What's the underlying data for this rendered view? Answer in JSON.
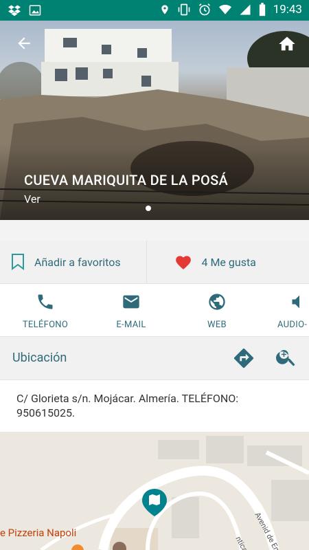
{
  "status_bar": {
    "time": "19:43"
  },
  "hero": {
    "title": "CUEVA MARIQUITA DE LA POSÁ",
    "subtitle": "Ver"
  },
  "actions": {
    "favorite_label": "Añadir a favoritos",
    "likes_label": "4 Me gusta"
  },
  "contacts": [
    {
      "label": "TELÉFONO",
      "icon": "phone-icon"
    },
    {
      "label": "E-MAIL",
      "icon": "email-icon"
    },
    {
      "label": "WEB",
      "icon": "globe-icon"
    },
    {
      "label": "AUDIO-",
      "icon": "audio-icon"
    }
  ],
  "location": {
    "title": "Ubicación",
    "address": "C/ Glorieta s/n. Mojácar. Almería. TELÉFONO: 950615025."
  },
  "map": {
    "poi_label": "e Pizzeria Napoli",
    "street_label": "Avenid de Encam",
    "street_label_2": "ntica"
  },
  "colors": {
    "status_bar": "#008273",
    "accent": "#2e6a7a",
    "heart": "#e53935",
    "marker": "#00838f"
  }
}
